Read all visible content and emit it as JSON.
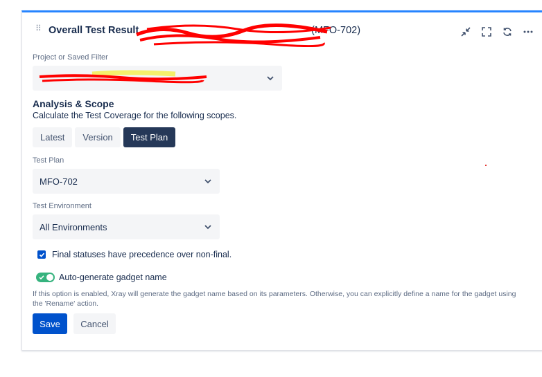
{
  "gadget": {
    "title_prefix": "Overall Test Result",
    "title_suffix": "- (MFO-702)"
  },
  "filter": {
    "label": "Project or Saved Filter",
    "value": ""
  },
  "scope": {
    "title": "Analysis & Scope",
    "description": "Calculate the Test Coverage for the following scopes.",
    "tabs": [
      {
        "label": "Latest",
        "active": false
      },
      {
        "label": "Version",
        "active": false
      },
      {
        "label": "Test Plan",
        "active": true
      }
    ]
  },
  "test_plan": {
    "label": "Test Plan",
    "value": "MFO-702"
  },
  "test_environment": {
    "label": "Test Environment",
    "value": "All Environments"
  },
  "final_statuses": {
    "label": "Final statuses have precedence over non-final.",
    "checked": true
  },
  "auto_name": {
    "label": "Auto-generate gadget name",
    "enabled": true,
    "help": "If this option is enabled, Xray will generate the gadget name based on its parameters. Otherwise, you can explicitly define a name for the gadget using the 'Rename' action."
  },
  "actions": {
    "save_label": "Save",
    "cancel_label": "Cancel"
  },
  "colors": {
    "accent": "#0052cc",
    "active_tab": "#253858",
    "toggle_on": "#36b37e",
    "top_border": "#2684ff",
    "redaction": "#ff0000"
  }
}
